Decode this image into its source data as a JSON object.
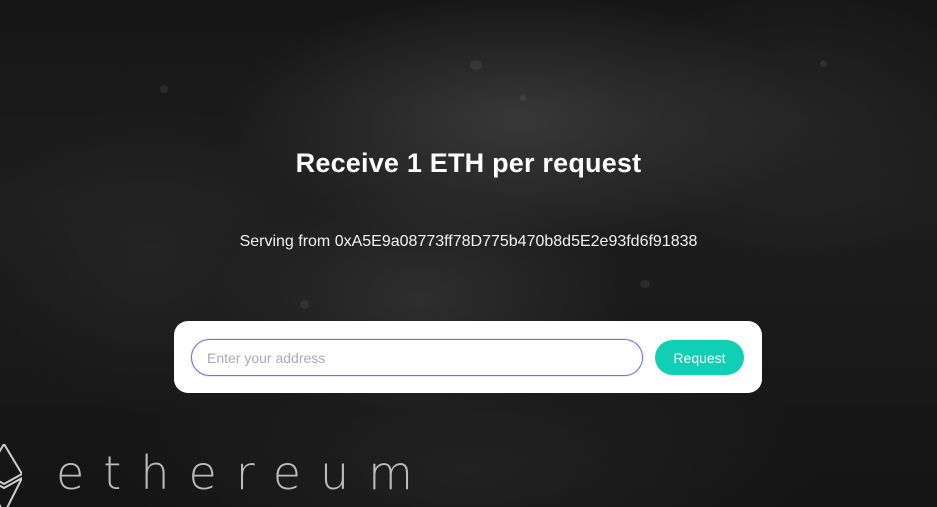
{
  "header": {
    "title": "Receive 1 ETH per request",
    "serving_text": "Serving from 0xA5E9a08773ff78D775b470b8d5E2e93fd6f91838"
  },
  "form": {
    "address_placeholder": "Enter your address",
    "address_value": "",
    "request_label": "Request"
  },
  "branding": {
    "wordmark": "ethereum",
    "logo_icon": "ethereum-diamond-icon"
  },
  "colors": {
    "accent_button": "#11cfb4",
    "input_border": "#6e72d9",
    "card_background": "#ffffff",
    "title_text": "#ffffff"
  }
}
